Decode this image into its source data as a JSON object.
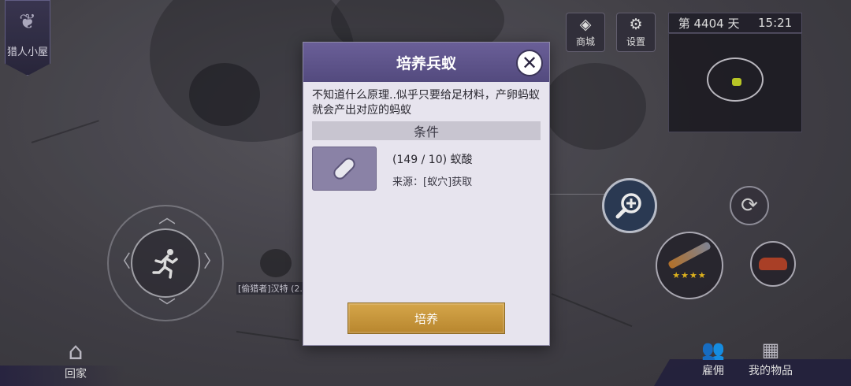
{
  "hud": {
    "hunter_hut_label": "猎人小屋",
    "shop_label": "商城",
    "settings_label": "设置",
    "day_text": "第 4404 天",
    "time_text": "15:21",
    "home_label": "回家",
    "hire_label": "雇佣",
    "items_label": "我的物品",
    "player_tag": "[偷猎者]汉特 (2..."
  },
  "weapon": {
    "stars": 4
  },
  "modal": {
    "title": "培养兵蚁",
    "description": "不知道什么原理..似乎只要给足材料，产卵蚂蚁就会产出对应的蚂蚁",
    "section_title": "条件",
    "requirement": {
      "amount": "(149 / 10) 蚁酸",
      "source": "来源：[蚁穴]获取"
    },
    "button_label": "培养"
  },
  "icons": {
    "shop": "diamond-icon",
    "settings": "gear-icon",
    "close": "close-icon",
    "zoom": "zoom-in-icon",
    "refresh": "refresh-icon",
    "run": "running-man-icon",
    "home": "house-icon",
    "hire": "people-icon",
    "items": "chest-icon"
  }
}
